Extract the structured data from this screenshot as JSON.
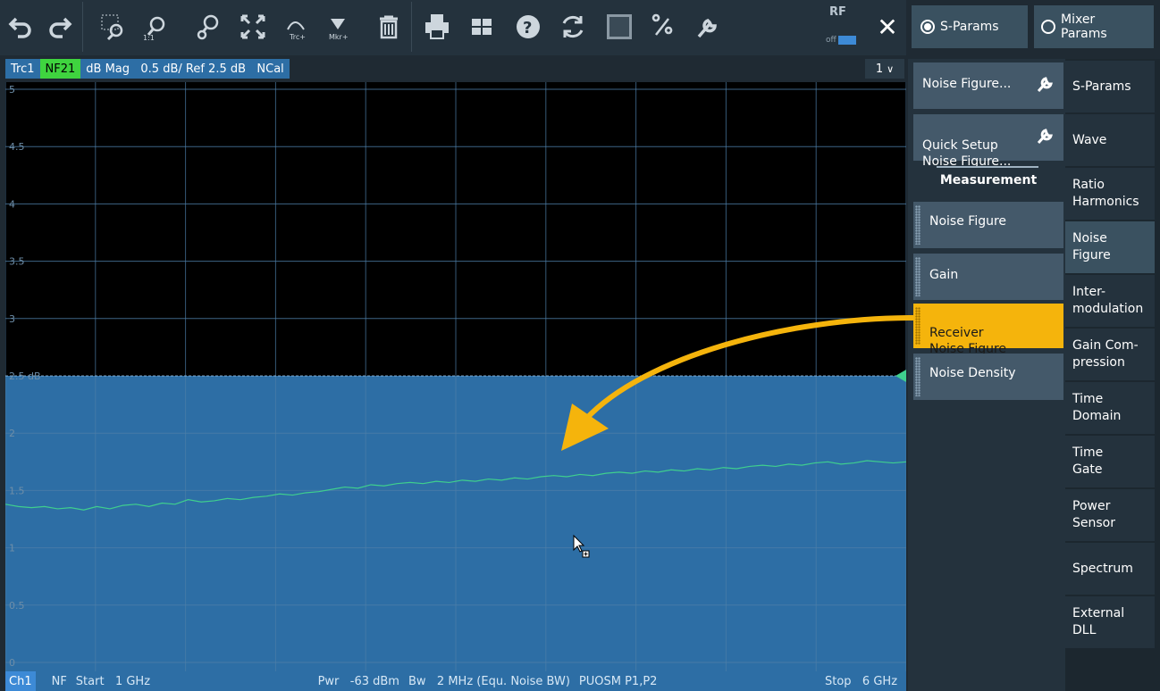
{
  "toolbar": {
    "buttons": [
      "undo-icon",
      "redo-icon",
      "zoom-window-icon",
      "zoom-1to1-icon",
      "zoom-settings-icon",
      "fit-icon",
      "add-trace-icon",
      "add-marker-icon",
      "delete-icon",
      "print-icon",
      "windows-icon",
      "help-icon",
      "refresh-icon",
      "screen-icon",
      "touch-icon",
      "wrench-icon"
    ],
    "rf_label": "RF",
    "rf_state": "off",
    "close_label": "✕"
  },
  "header": {
    "radio_sparams": "S-Params",
    "radio_mixer": "Mixer\nParams",
    "selected": "S-Params"
  },
  "trace": {
    "name": "Trc1",
    "meas": "NF21",
    "info": "dB Mag   0.5 dB/ Ref 2.5 dB   NCal",
    "channel_select": "1"
  },
  "chart_data": {
    "type": "line",
    "title": "",
    "xlabel": "",
    "ylabel": "",
    "ylim": [
      0,
      5
    ],
    "yticks": [
      "0",
      "0.5",
      "1",
      "1.5",
      "2",
      "2.5 dB",
      "3",
      "3.5",
      "4",
      "4.5",
      "5"
    ],
    "ref_value": 2.5,
    "x_start_ghz": 1,
    "x_stop_ghz": 6,
    "series": [
      {
        "values": [
          1.38,
          1.36,
          1.35,
          1.36,
          1.34,
          1.35,
          1.33,
          1.36,
          1.34,
          1.37,
          1.38,
          1.36,
          1.39,
          1.38,
          1.42,
          1.4,
          1.41,
          1.43,
          1.42,
          1.44,
          1.45,
          1.47,
          1.46,
          1.48,
          1.49,
          1.51,
          1.53,
          1.52,
          1.55,
          1.54,
          1.56,
          1.57,
          1.56,
          1.58,
          1.57,
          1.59,
          1.58,
          1.6,
          1.59,
          1.61,
          1.6,
          1.62,
          1.63,
          1.62,
          1.64,
          1.63,
          1.65,
          1.66,
          1.65,
          1.67,
          1.66,
          1.68,
          1.67,
          1.69,
          1.68,
          1.7,
          1.69,
          1.71,
          1.72,
          1.71,
          1.73,
          1.72,
          1.74,
          1.75,
          1.73,
          1.74,
          1.76,
          1.75,
          1.74,
          1.75
        ]
      }
    ],
    "grid": true,
    "colors": {
      "trace": "#3fcf8e",
      "below_ref_fill": "#2d6ea5",
      "ref_marker": "#3fcf8e",
      "grid": "#3a4a56"
    }
  },
  "status": {
    "ch": "Ch1",
    "meas": "NF",
    "start": "Start   1 GHz",
    "pwr": "Pwr   -63 dBm",
    "bw": "Bw   2 MHz (Equ. Noise BW)",
    "puosm": "PUOSM P1,P2",
    "stop": "Stop   6 GHz"
  },
  "panel": {
    "noise_figure_setup": "Noise Figure...",
    "quick_setup": "Quick Setup\nNoise Figure...",
    "measurement_head": "Measurement",
    "items": [
      "Noise Figure",
      "Gain",
      "Receiver\nNoise Figure",
      "Noise Density"
    ],
    "active_item": "Receiver\nNoise Figure"
  },
  "tabs": {
    "items": [
      "S-Params",
      "Wave",
      "Ratio\nHarmonics",
      "Noise\nFigure",
      "Inter-\nmodulation",
      "Gain Com-\npression",
      "Time\nDomain",
      "Time\nGate",
      "Power\nSensor",
      "Spectrum",
      "External\nDLL"
    ],
    "selected": "Noise\nFigure"
  },
  "colors": {
    "accent": "#f5b40c",
    "trace_header": "#2d6ea5",
    "meas_green": "#3fd43f"
  }
}
